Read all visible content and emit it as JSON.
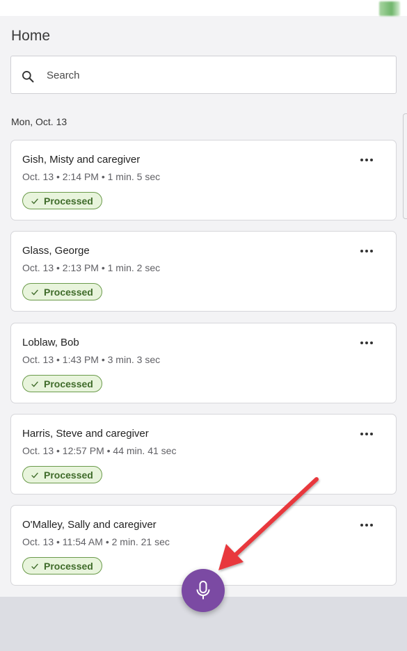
{
  "page": {
    "title": "Home"
  },
  "search": {
    "placeholder": "Search",
    "icon": "search-icon"
  },
  "date_header": "Mon, Oct. 13",
  "cards": [
    {
      "name": "Gish, Misty and caregiver",
      "meta": "Oct. 13 • 2:14 PM • 1 min. 5 sec",
      "status": "Processed"
    },
    {
      "name": "Glass, George",
      "meta": "Oct. 13 • 2:13 PM • 1 min. 2 sec",
      "status": "Processed"
    },
    {
      "name": "Loblaw, Bob",
      "meta": "Oct. 13 • 1:43 PM • 3 min. 3 sec",
      "status": "Processed"
    },
    {
      "name": "Harris, Steve and caregiver",
      "meta": "Oct. 13 • 12:57 PM • 44 min. 41 sec",
      "status": "Processed"
    },
    {
      "name": "O'Malley, Sally and caregiver",
      "meta": "Oct. 13 • 11:54 AM • 2 min. 21 sec",
      "status": "Processed"
    }
  ],
  "colors": {
    "accent": "#7b4aa3",
    "status_bg": "#e8f4dc",
    "status_text": "#3f6b2a",
    "annotation_arrow": "#e8383d"
  },
  "record_button": {
    "icon": "microphone-icon"
  }
}
